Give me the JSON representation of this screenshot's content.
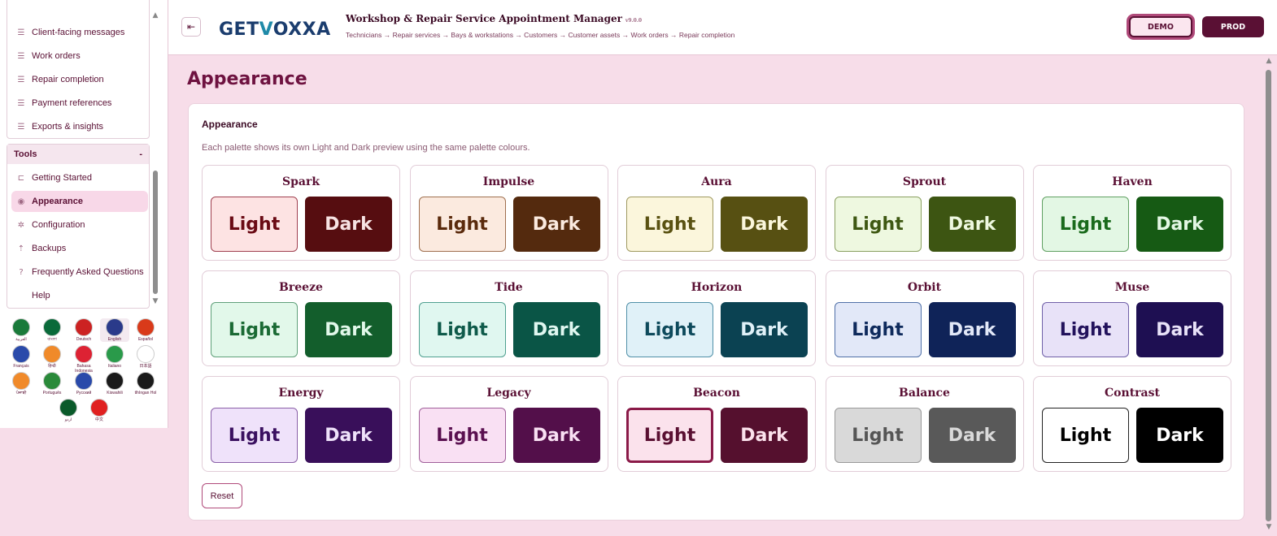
{
  "sidebar": {
    "top_items": [
      {
        "label": "Client-facing messages",
        "icon": "list-icon"
      },
      {
        "label": "Work orders",
        "icon": "list-icon"
      },
      {
        "label": "Repair completion",
        "icon": "list-icon"
      },
      {
        "label": "Payment references",
        "icon": "list-icon"
      },
      {
        "label": "Exports & insights",
        "icon": "list-icon"
      }
    ],
    "tools": {
      "title": "Tools",
      "toggle": "-",
      "items": [
        {
          "label": "Getting Started",
          "icon": "start-icon"
        },
        {
          "label": "Appearance",
          "icon": "palette-icon",
          "active": true
        },
        {
          "label": "Configuration",
          "icon": "gear-icon"
        },
        {
          "label": "Backups",
          "icon": "upload-icon"
        },
        {
          "label": "Frequently Asked Questions",
          "icon": "help-icon"
        },
        {
          "label": "Help",
          "icon": ""
        }
      ]
    },
    "languages": [
      {
        "label": "العربية",
        "color": "#1a7a3a"
      },
      {
        "label": "বাংলা",
        "color": "#0a6a3a"
      },
      {
        "label": "Deutsch",
        "color": "#cc2222"
      },
      {
        "label": "English",
        "color": "#2a3a8a"
      },
      {
        "label": "Español",
        "color": "#d93a1a"
      },
      {
        "label": "Français",
        "color": "#2a4aaa"
      },
      {
        "label": "हिन्दी",
        "color": "#f08a2a"
      },
      {
        "label": "Bahasa Indonesia",
        "color": "#dd2233"
      },
      {
        "label": "Italiano",
        "color": "#2a9a4a"
      },
      {
        "label": "日本語",
        "color": "#ffffff"
      },
      {
        "label": "ਪੰਜਾਬੀ",
        "color": "#f08a2a"
      },
      {
        "label": "Português",
        "color": "#2a8a3a"
      },
      {
        "label": "Русский",
        "color": "#2a4aaa"
      },
      {
        "label": "Kiswahili",
        "color": "#1a1a1a"
      },
      {
        "label": "tlhIngan Hol",
        "color": "#1a1a1a"
      },
      {
        "label": "اردو",
        "color": "#0a5a2a"
      },
      {
        "label": "中文",
        "color": "#e02020"
      }
    ]
  },
  "header": {
    "collapse_icon": "collapse-menu-icon",
    "logo_left": "GET",
    "logo_v": "V",
    "logo_right": "OXXA",
    "title": "Workshop & Repair Service Appointment Manager",
    "version": "v9.0.0",
    "subtitle": "Technicians → Repair services → Bays & workstations → Customers → Customer assets → Work orders → Repair completion",
    "demo_label": "DEMO",
    "prod_label": "PROD"
  },
  "main": {
    "page_title": "Appearance",
    "card_title": "Appearance",
    "card_desc": "Each palette shows its own Light and Dark preview using the same palette colours.",
    "light_label": "Light",
    "dark_label": "Dark",
    "reset_label": "Reset",
    "palettes": [
      {
        "name": "Spark",
        "light_bg": "#fde3e3",
        "light_fg": "#6a0a14",
        "light_border": "#a04050",
        "dark_bg": "#560d10",
        "dark_fg": "#f7e3e3"
      },
      {
        "name": "Impulse",
        "light_bg": "#fbeadf",
        "light_fg": "#5a2a0c",
        "light_border": "#a07050",
        "dark_bg": "#542a0e",
        "dark_fg": "#fbeadf"
      },
      {
        "name": "Aura",
        "light_bg": "#fbf6dc",
        "light_fg": "#5a5212",
        "light_border": "#a09a60",
        "dark_bg": "#575012",
        "dark_fg": "#fbf6dc"
      },
      {
        "name": "Sprout",
        "light_bg": "#eef8e0",
        "light_fg": "#3e5812",
        "light_border": "#8aa060",
        "dark_bg": "#3d5512",
        "dark_fg": "#eef8e0"
      },
      {
        "name": "Haven",
        "light_bg": "#e3f7e4",
        "light_fg": "#1a6a1c",
        "light_border": "#60a062",
        "dark_bg": "#165a14",
        "dark_fg": "#e3f7e4"
      },
      {
        "name": "Breeze",
        "light_bg": "#e2f8ea",
        "light_fg": "#1a6a34",
        "light_border": "#60a07a",
        "dark_bg": "#135e2c",
        "dark_fg": "#e2f8ea"
      },
      {
        "name": "Tide",
        "light_bg": "#e0f7f0",
        "light_fg": "#0e5a4a",
        "light_border": "#50a090",
        "dark_bg": "#0a5546",
        "dark_fg": "#e0f7f0"
      },
      {
        "name": "Horizon",
        "light_bg": "#e0f1f8",
        "light_fg": "#0e4a5c",
        "light_border": "#5090a8",
        "dark_bg": "#0b4252",
        "dark_fg": "#e0f1f8"
      },
      {
        "name": "Orbit",
        "light_bg": "#e2e8f8",
        "light_fg": "#0e2a5c",
        "light_border": "#5070a8",
        "dark_bg": "#0f2358",
        "dark_fg": "#e2e8f8"
      },
      {
        "name": "Muse",
        "light_bg": "#e8e2f8",
        "light_fg": "#22125c",
        "light_border": "#7060a8",
        "dark_bg": "#1e0f52",
        "dark_fg": "#e8e2f8"
      },
      {
        "name": "Energy",
        "light_bg": "#efe2fa",
        "light_fg": "#3a1060",
        "light_border": "#8a60a8",
        "dark_bg": "#390f5a",
        "dark_fg": "#efe2fa"
      },
      {
        "name": "Legacy",
        "light_bg": "#f9e0f3",
        "light_fg": "#5a1050",
        "light_border": "#a0609a",
        "dark_bg": "#530f4a",
        "dark_fg": "#f9e0f3"
      },
      {
        "name": "Beacon",
        "light_bg": "#fbe2ec",
        "light_fg": "#5a1032",
        "light_border": "#8a1a48",
        "dark_bg": "#55102e",
        "dark_fg": "#fbe2ec",
        "selected": true
      },
      {
        "name": "Balance",
        "light_bg": "#d9d9d9",
        "light_fg": "#555555",
        "light_border": "#999999",
        "dark_bg": "#595959",
        "dark_fg": "#d9d9d9"
      },
      {
        "name": "Contrast",
        "light_bg": "#ffffff",
        "light_fg": "#000000",
        "light_border": "#222222",
        "dark_bg": "#000000",
        "dark_fg": "#ffffff"
      }
    ]
  }
}
